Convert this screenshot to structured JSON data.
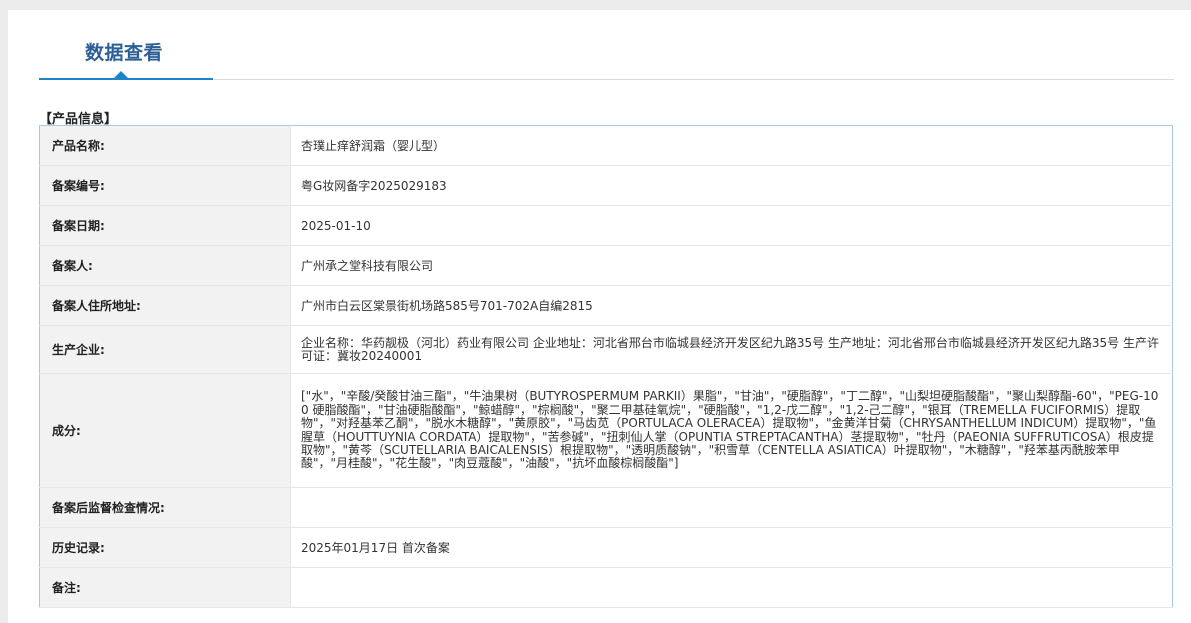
{
  "page": {
    "tab_title": "数据查看",
    "section_label": "【产品信息】"
  },
  "rows": [
    {
      "label": "产品名称:",
      "value": "杏璞止痒舒润霜（婴儿型）"
    },
    {
      "label": "备案编号:",
      "value": "粤G妆网备字2025029183"
    },
    {
      "label": "备案日期:",
      "value": "2025-01-10"
    },
    {
      "label": "备案人:",
      "value": "广州承之堂科技有限公司"
    },
    {
      "label": "备案人住所地址:",
      "value": "广州市白云区棠景街机场路585号701-702A自编2815"
    },
    {
      "label": "生产企业:",
      "value": "企业名称：华药靓极（河北）药业有限公司 企业地址：河北省邢台市临城县经济开发区纪九路35号 生产地址：河北省邢台市临城县经济开发区纪九路35号 生产许可证：冀妆20240001"
    },
    {
      "label": "成分:",
      "value": "[\"水\"，\"辛酸/癸酸甘油三酯\"，\"牛油果树（BUTYROSPERMUM PARKII）果脂\"，\"甘油\"，\"硬脂醇\"，\"丁二醇\"，\"山梨坦硬脂酸酯\"，\"聚山梨醇酯-60\"，\"PEG-100 硬脂酸酯\"，\"甘油硬脂酸酯\"，\"鲸蜡醇\"，\"棕榈酸\"，\"聚二甲基硅氧烷\"，\"硬脂酸\"，\"1,2-戊二醇\"，\"1,2-己二醇\"，\"银耳（TREMELLA FUCIFORMIS）提取物\"，\"对羟基苯乙酮\"，\"脱水木糖醇\"，\"黄原胶\"，\"马齿苋（PORTULACA OLERACEA）提取物\"，\"金黄洋甘菊（CHRYSANTHELLUM INDICUM）提取物\"，\"鱼腥草（HOUTTUYNIA CORDATA）提取物\"，\"苦参碱\"，\"扭刺仙人掌（OPUNTIA STREPTACANTHA）茎提取物\"，\"牡丹（PAEONIA SUFFRUTICOSA）根皮提取物\"，\"黄芩（SCUTELLARIA BAICALENSIS）根提取物\"，\"透明质酸钠\"，\"积雪草（CENTELLA ASIATICA）叶提取物\"，\"木糖醇\"，\"羟苯基丙酰胺苯甲酸\"，\"月桂酸\"，\"花生酸\"，\"肉豆蔻酸\"，\"油酸\"，\"抗坏血酸棕榈酸酯\"]"
    },
    {
      "label": "备案后监督检查情况:",
      "value": ""
    },
    {
      "label": "历史记录:",
      "value": "2025年01月17日 首次备案"
    },
    {
      "label": "备注:",
      "value": ""
    }
  ],
  "colors": {
    "accent": "#1d84c9",
    "title": "#2d5f96",
    "table_border": "#a9c7e6",
    "label_bg": "#f2f2f2"
  }
}
